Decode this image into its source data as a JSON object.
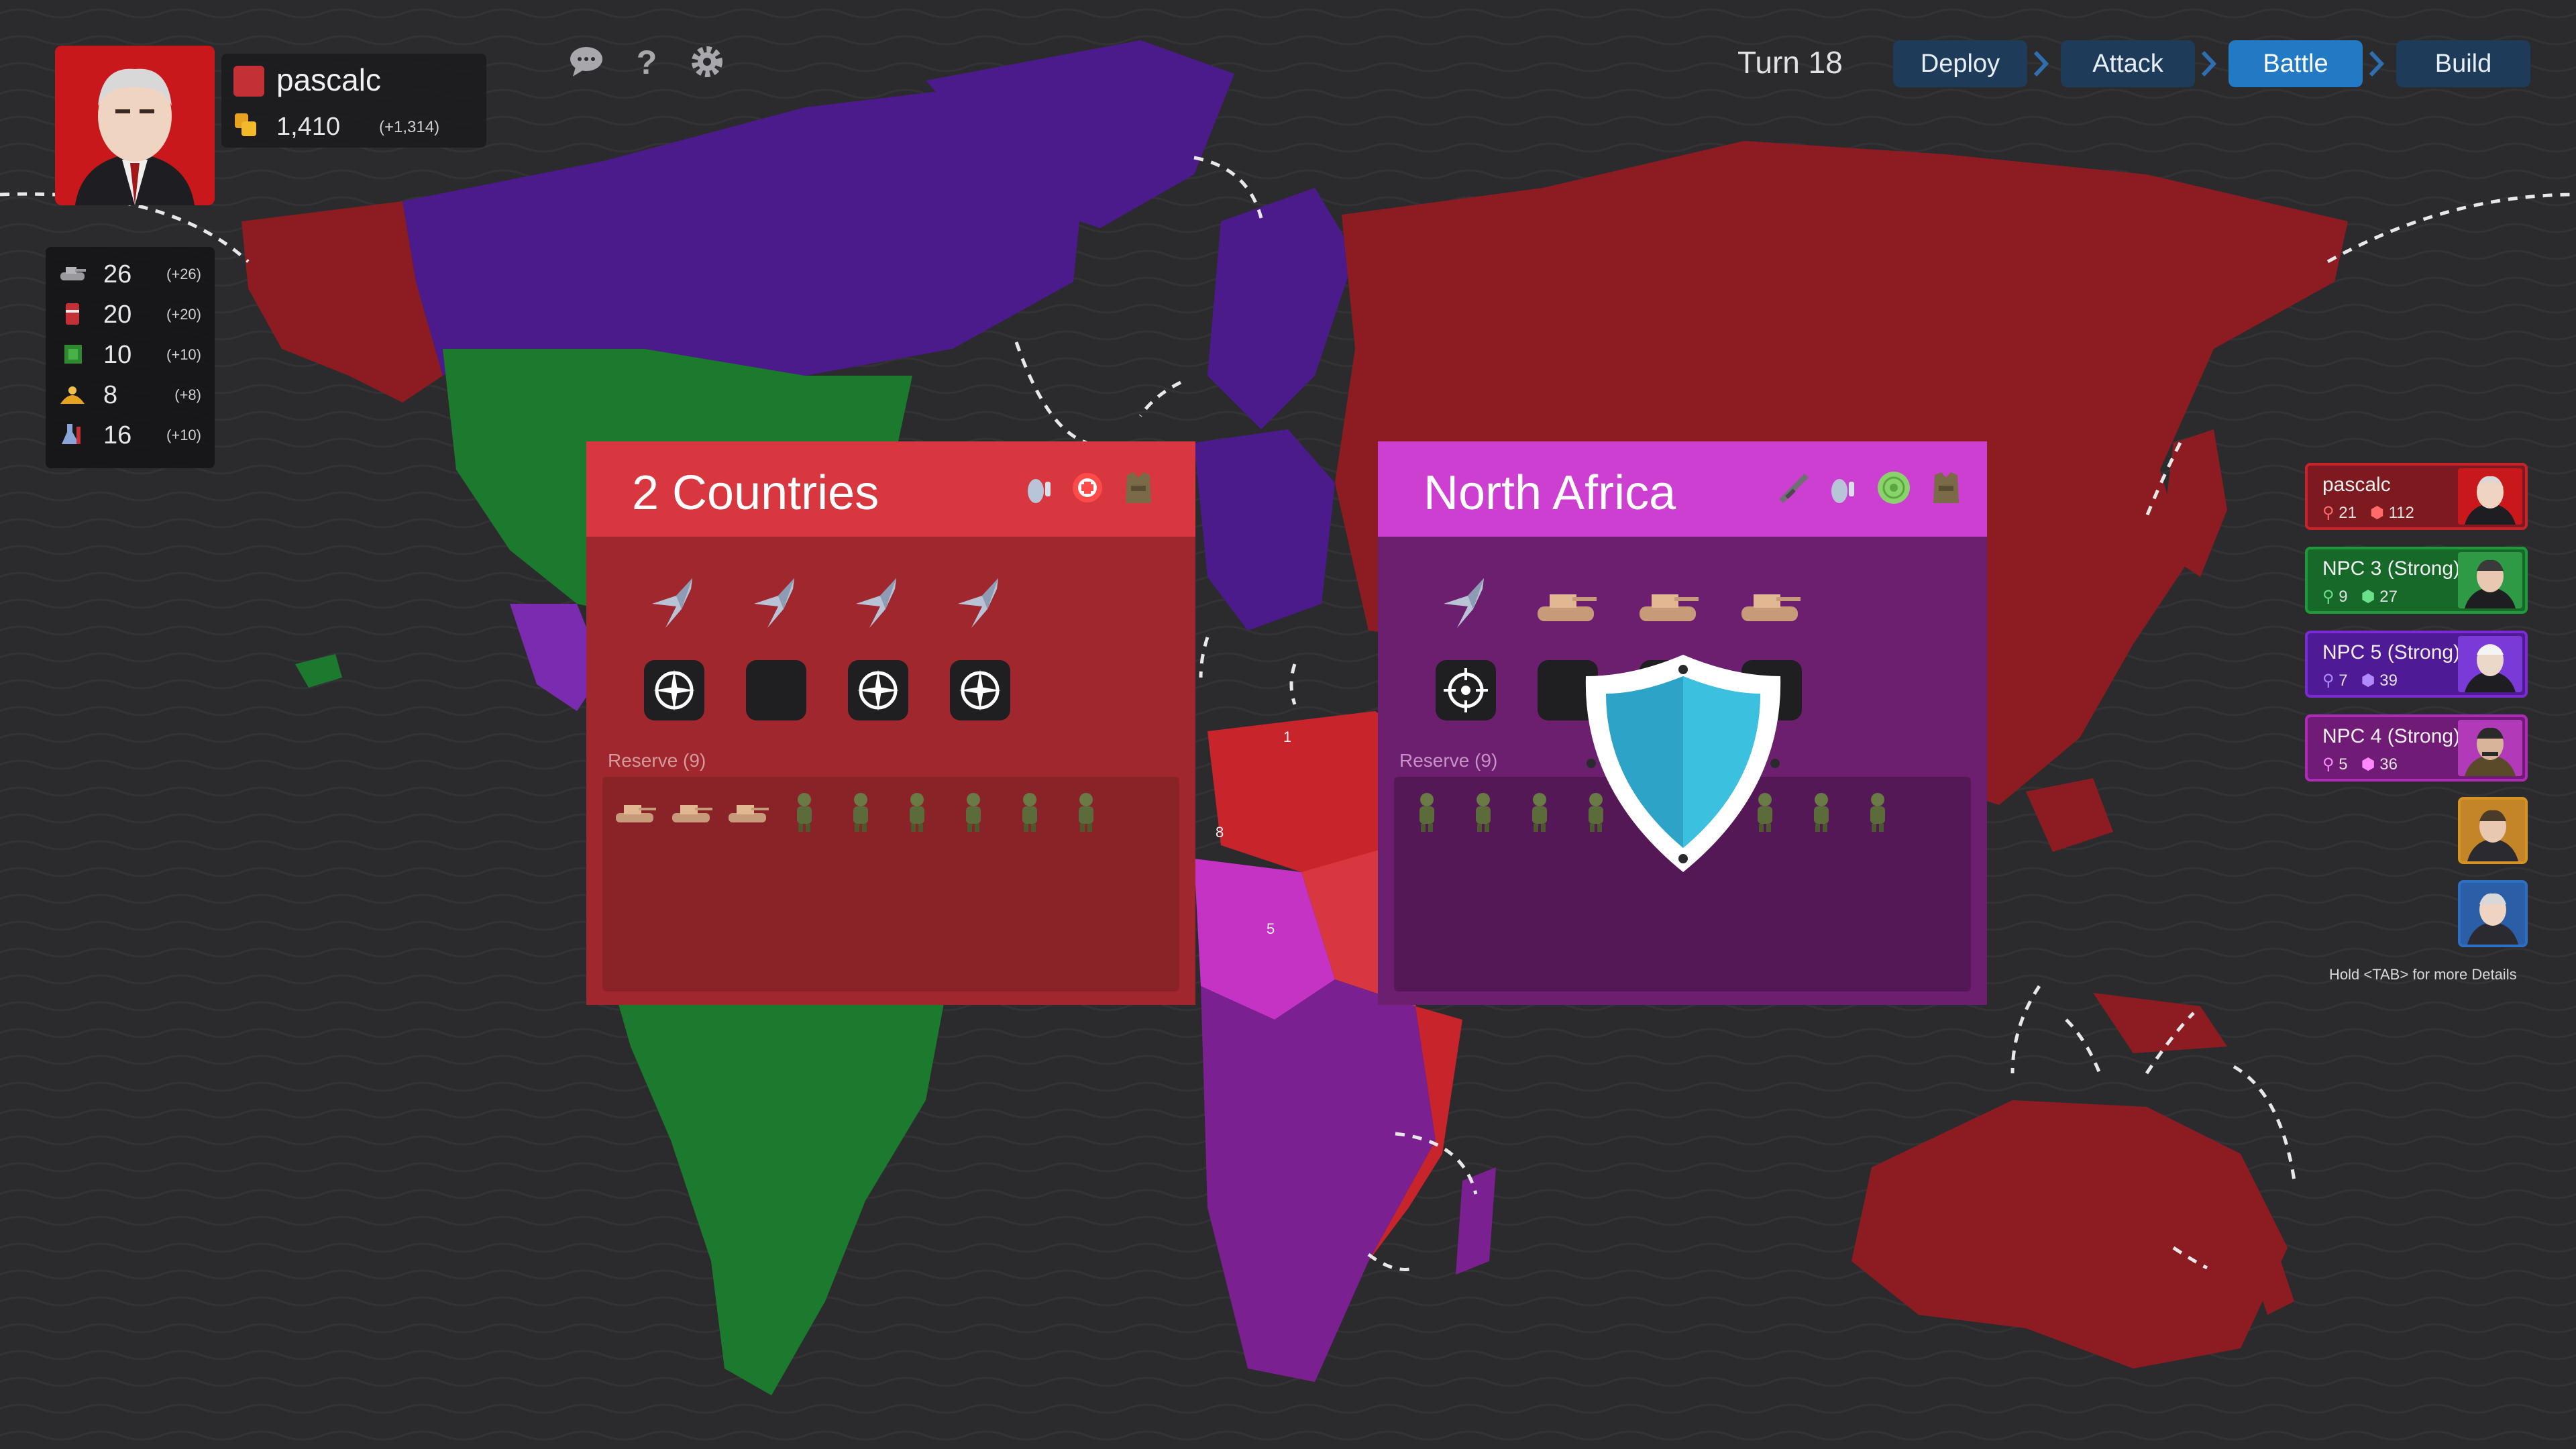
{
  "player": {
    "name": "pascalc",
    "color": "#c33036",
    "gold": "1,410",
    "gold_delta": "(+1,314)"
  },
  "resources": [
    {
      "icon": "tank-resource-icon",
      "value": "26",
      "delta": "(+26)"
    },
    {
      "icon": "fuel-barrel-icon",
      "value": "20",
      "delta": "(+20)"
    },
    {
      "icon": "circuit-chip-icon",
      "value": "10",
      "delta": "(+10)"
    },
    {
      "icon": "food-icon",
      "value": "8",
      "delta": "(+8)"
    },
    {
      "icon": "science-flask-icon",
      "value": "16",
      "delta": "(+10)"
    }
  ],
  "top_icons": [
    "chat-icon",
    "help-icon",
    "settings-gear-icon"
  ],
  "turn": "Turn 18",
  "phases": {
    "deploy": "Deploy",
    "attack": "Attack",
    "battle": "Battle",
    "build": "Build",
    "active": "Battle"
  },
  "battle": {
    "attacker": {
      "title": "2 Countries",
      "color": "#d9373f",
      "modifiers": [
        "grenade-ability-icon",
        "medic-ability-icon",
        "armor-vest-icon"
      ],
      "front_units": [
        "jet",
        "jet",
        "jet",
        "jet"
      ],
      "slots": [
        "compass-target",
        "empty",
        "compass-target",
        "compass-target"
      ],
      "reserve_label": "Reserve (9)",
      "reserve_units": [
        "tank",
        "tank",
        "tank",
        "soldier",
        "soldier",
        "soldier",
        "soldier",
        "soldier",
        "soldier"
      ]
    },
    "defender": {
      "title": "North Africa",
      "color": "#cc3fd0",
      "modifiers": [
        "rifle-ability-icon",
        "grenade-ability-icon",
        "radar-ability-icon",
        "armor-vest-icon"
      ],
      "front_units": [
        "jet",
        "tank",
        "tank",
        "tank"
      ],
      "slots": [
        "crosshair-target",
        "empty",
        "empty",
        "empty"
      ],
      "reserve_label": "Reserve (9)",
      "reserve_units": [
        "soldier",
        "soldier",
        "soldier",
        "soldier",
        "soldier",
        "soldier",
        "soldier",
        "soldier",
        "soldier"
      ],
      "defense_shield": true
    }
  },
  "players_list": [
    {
      "name": "pascalc",
      "territories": "21",
      "units": "112",
      "color": "#c8232b"
    },
    {
      "name": "NPC 3 (Strong)",
      "territories": "9",
      "units": "27",
      "color": "#1f9a3a"
    },
    {
      "name": "NPC 5 (Strong)",
      "territories": "7",
      "units": "39",
      "color": "#7a2bd2"
    },
    {
      "name": "NPC 4 (Strong)",
      "territories": "5",
      "units": "36",
      "color": "#b02ab8"
    }
  ],
  "eliminated_players": [
    {
      "color": "#d49322"
    },
    {
      "color": "#2d6fc2"
    }
  ],
  "hint": "Hold <TAB> for more Details",
  "map_numbers": [
    "1",
    "8",
    "5"
  ]
}
